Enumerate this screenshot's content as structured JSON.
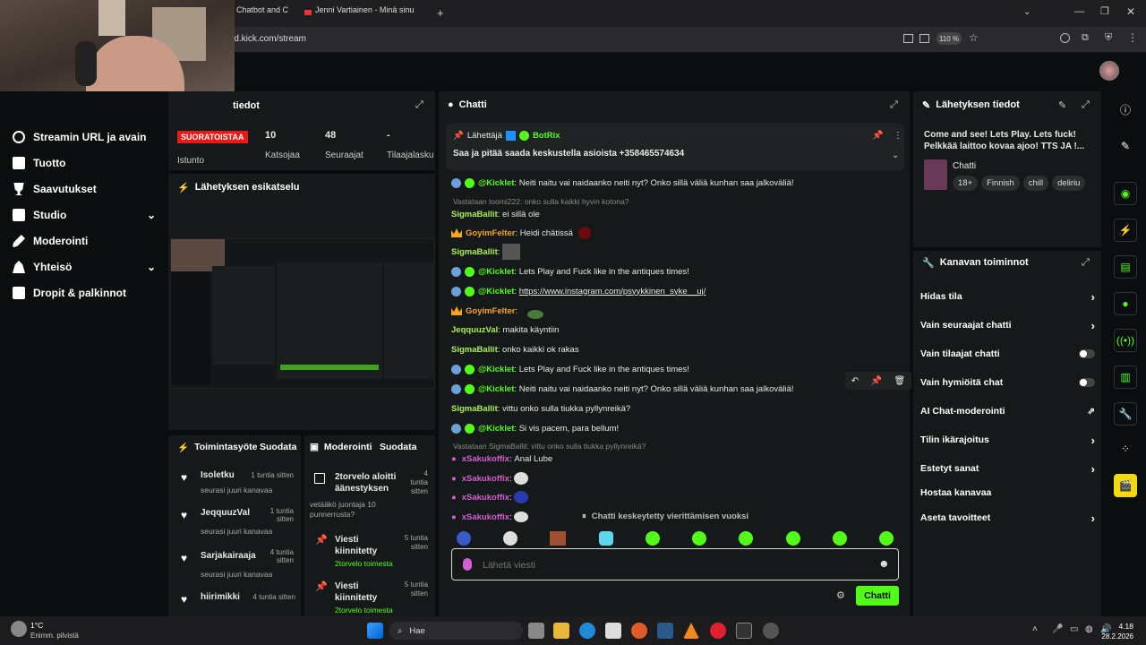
{
  "browser": {
    "tabs": [
      "Chatbot and C",
      "Jenni Vartiainen - Minä sinua va"
    ],
    "new_tab": "+",
    "url": "rd.kick.com/stream",
    "zoom": "110 %"
  },
  "left_nav": {
    "items": [
      {
        "label": "Streamin URL ja avain",
        "icon": "key-icon"
      },
      {
        "label": "Tuotto",
        "icon": "money-icon"
      },
      {
        "label": "Saavutukset",
        "icon": "trophy-icon"
      },
      {
        "label": "Studio",
        "icon": "studio-icon",
        "expandable": true
      },
      {
        "label": "Moderointi",
        "icon": "wrench-icon"
      },
      {
        "label": "Yhteisö",
        "icon": "community-icon",
        "expandable": true
      },
      {
        "label": "Dropit & palkinnot",
        "icon": "drops-icon"
      }
    ]
  },
  "stats": {
    "panel_title": "tiedot",
    "live_badge": "SUORATOISTAA",
    "session_label": "Istunto",
    "viewers": "10",
    "viewers_label": "Katsojaa",
    "followers": "48",
    "followers_label": "Seuraajat",
    "subs": "-",
    "subs_label": "Tilaajalasku"
  },
  "preview": {
    "title": "Lähetyksen esikatselu"
  },
  "activity": {
    "title": "Toimintasyöte",
    "filter": "Suodata",
    "items": [
      {
        "user": "Isoletku",
        "time": "1 tuntia sitten",
        "text": "seurasi juuri kanavaa"
      },
      {
        "user": "JeqquuzVal",
        "time": "1 tuntia sitten",
        "text": "seurasi juuri kanavaa"
      },
      {
        "user": "Sarjakairaaja",
        "time": "4 tuntia sitten",
        "text": "seurasi juuri kanavaa"
      },
      {
        "user": "hiirimikki",
        "time": "4 tuntia sitten",
        "text": "seurasi juuri kanavaa"
      }
    ]
  },
  "moderation": {
    "title": "Moderointi",
    "filter": "Suodata",
    "items": [
      {
        "title": "2torvelo aloitti äänestyksen",
        "time": "4 tuntia sitten",
        "text": "vetääkö juontaja 10 punnerrusta?"
      },
      {
        "title": "Viesti kiinnitetty",
        "time": "5 tuntia sitten",
        "text": "2torvelo toimesta"
      },
      {
        "title": "Viesti kiinnitetty",
        "time": "5 tuntia sitten",
        "text": "2torvelo toimesta"
      }
    ]
  },
  "chat": {
    "title": "Chatti",
    "pinned": {
      "label": "Lähettäjä",
      "user": "BotRix",
      "text": "Saa ja pitää saada keskustella asioista +358465574634"
    },
    "messages": [
      {
        "user": "@Kicklet",
        "style": "bot",
        "text": "Neiti naitu vai naidaanko neiti nyt? Onko sillä väliä kunhan saa jalkoväliä!"
      },
      {
        "reply": "Vastataan toomi222: onko sulla kaikki hyvin kotona?"
      },
      {
        "user": "SigmaBallit",
        "style": "green",
        "text": "ei sillä ole"
      },
      {
        "user": "GoyimFelter",
        "style": "orange",
        "text": "Heidi chätissä"
      },
      {
        "user": "SigmaBallit",
        "style": "green",
        "text": ""
      },
      {
        "user": "@Kicklet",
        "style": "bot",
        "text": "Lets Play and Fuck like in the antiques times!"
      },
      {
        "user": "@Kicklet",
        "style": "bot",
        "text": "https://www.instagram.com/psyykkinen_syke__uj/"
      },
      {
        "user": "GoyimFelter",
        "style": "orange",
        "text": ""
      },
      {
        "user": "JeqquuzVal",
        "style": "green",
        "text": "makita käyntiin"
      },
      {
        "user": "SigmaBallit",
        "style": "green",
        "text": "onko kaikki ok rakas"
      },
      {
        "user": "@Kicklet",
        "style": "bot",
        "text": "Lets Play and Fuck like in the antiques times!"
      },
      {
        "user": "@Kicklet",
        "style": "bot",
        "text": "Neiti naitu vai naidaanko neiti nyt? Onko sillä väliä kunhan saa jalkoväliä!"
      },
      {
        "user": "SigmaBallit",
        "style": "green",
        "text": "vittu onko sulla tiukka pyllynreikä?"
      },
      {
        "user": "@Kicklet",
        "style": "bot",
        "text": "Si vis pacem, para bellum!"
      },
      {
        "reply": "Vastataan SigmaBallit: vittu onko sulla tiukka pyllynreikä?"
      },
      {
        "user": "xSakukoffix",
        "style": "purple",
        "text": "Anal Lube"
      },
      {
        "user": "xSakukoffix",
        "style": "purple",
        "text": ""
      },
      {
        "user": "xSakukoffix",
        "style": "purple",
        "text": ""
      },
      {
        "user": "xSakukoffix",
        "style": "purple",
        "text": ""
      }
    ],
    "paused": "Chatti keskeytetty vierittämisen vuoksi",
    "input_placeholder": "Lähetä viesti",
    "send_label": "Chatti"
  },
  "stream_info": {
    "title": "Lähetyksen tiedot",
    "stream_title": "Come and see! Lets Play. Lets fuck! Pelkkää laittoo kovaa ajoo! TTS JA !...",
    "category": "Chatti",
    "tags": [
      "18+",
      "Finnish",
      "chill",
      "deliriu"
    ]
  },
  "channel_actions": {
    "title": "Kanavan toiminnot",
    "items": [
      {
        "label": "Hidas tila",
        "control": "chevron"
      },
      {
        "label": "Vain seuraajat chatti",
        "control": "chevron"
      },
      {
        "label": "Vain tilaajat chatti",
        "control": "toggle"
      },
      {
        "label": "Vain hymiöitä chat",
        "control": "toggle"
      },
      {
        "label": "AI Chat-moderointi",
        "control": "external"
      },
      {
        "label": "Tilin ikärajoitus",
        "control": "chevron"
      },
      {
        "label": "Estetyt sanat",
        "control": "chevron"
      },
      {
        "label": "Hostaa kanavaa",
        "control": "none"
      },
      {
        "label": "Aseta tavoitteet",
        "control": "chevron"
      }
    ]
  },
  "taskbar": {
    "temp": "1°C",
    "weather": "Enimm. pilvistä",
    "search": "Hae",
    "time": "4.18",
    "date": "28.2.2026"
  },
  "colors": {
    "accent": "#53fc18",
    "live": "#e91916",
    "bg": "#0b0e0f",
    "panel": "#16191a"
  }
}
